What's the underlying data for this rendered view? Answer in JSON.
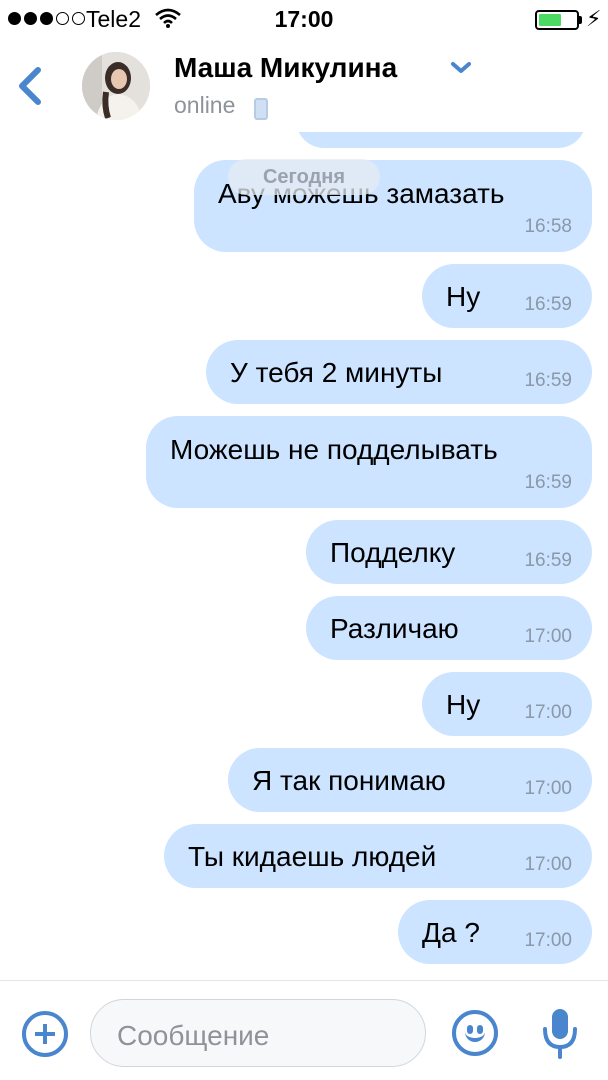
{
  "status_bar": {
    "carrier": "Tele2",
    "time": "17:00",
    "battery_level": 0.6,
    "signal_bars": 3,
    "signal_total": 5
  },
  "header": {
    "contact_name": "Маша Микулина",
    "presence": "online"
  },
  "chat": {
    "date_label": "Сегодня",
    "messages": [
      {
        "text": "Аву можешь замазать",
        "time": "16:58"
      },
      {
        "text": "Ну",
        "time": "16:59"
      },
      {
        "text": "У тебя 2 минуты",
        "time": "16:59"
      },
      {
        "text": "Можешь не подделывать",
        "time": "16:59"
      },
      {
        "text": "Подделку",
        "time": "16:59"
      },
      {
        "text": "Различаю",
        "time": "17:00"
      },
      {
        "text": "Ну",
        "time": "17:00"
      },
      {
        "text": "Я так понимаю",
        "time": "17:00"
      },
      {
        "text": "Ты кидаешь людей",
        "time": "17:00"
      },
      {
        "text": "Да ?",
        "time": "17:00"
      }
    ]
  },
  "composer": {
    "placeholder": "Сообщение"
  },
  "colors": {
    "accent": "#4a86cd",
    "bubble_outgoing": "#cce4ff",
    "battery_fill": "#4cd964",
    "secondary_text": "#8e9399"
  },
  "icons": [
    "back-chevron-icon",
    "chevron-down-icon",
    "phone-icon",
    "wifi-icon",
    "battery-icon",
    "charging-bolt-icon",
    "plus-circle-icon",
    "emoji-icon",
    "microphone-icon"
  ]
}
